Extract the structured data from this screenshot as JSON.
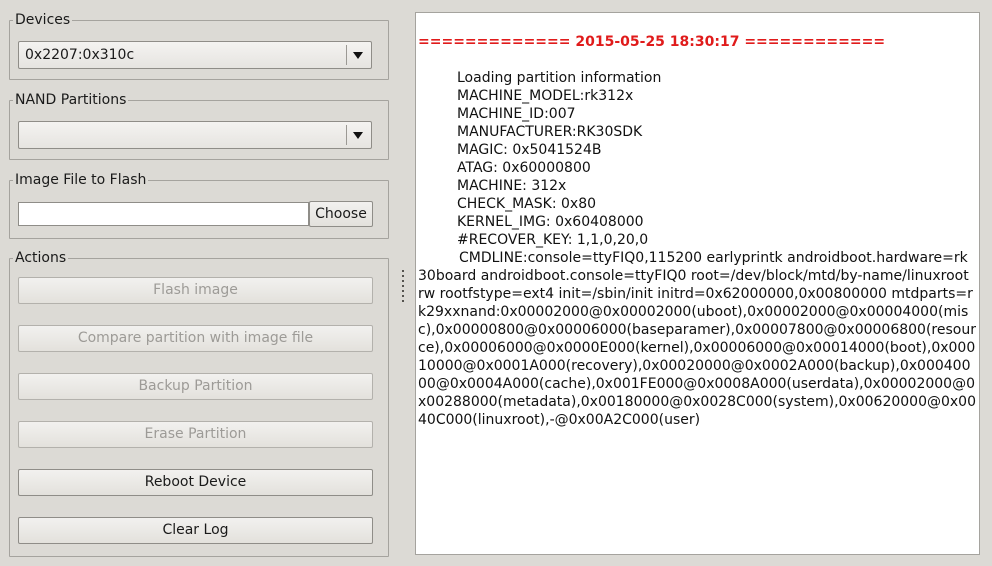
{
  "devices": {
    "title": "Devices",
    "selected": "0x2207:0x310c"
  },
  "nand_partitions": {
    "title": "NAND Partitions",
    "selected": ""
  },
  "image_file": {
    "title": "Image File to Flash",
    "value": "",
    "choose_label": "Choose"
  },
  "actions": {
    "title": "Actions",
    "flash_image": "Flash image",
    "compare_partition": "Compare partition with image file",
    "backup_partition": "Backup Partition",
    "erase_partition": "Erase Partition",
    "reboot_device": "Reboot Device",
    "clear_log": "Clear Log"
  },
  "log": {
    "header": "============= 2015-05-25 18:30:17 ============",
    "lines": [
      "Loading partition information",
      "MACHINE_MODEL:rk312x",
      "MACHINE_ID:007",
      "MANUFACTURER:RK30SDK",
      "MAGIC: 0x5041524B",
      "ATAG: 0x60000800",
      "MACHINE: 312x",
      "CHECK_MASK: 0x80",
      "KERNEL_IMG: 0x60408000",
      "#RECOVER_KEY: 1,1,0,20,0"
    ],
    "cmdline": "CMDLINE:console=ttyFIQ0,115200 earlyprintk androidboot.hardware=rk30board androidboot.console=ttyFIQ0 root=/dev/block/mtd/by-name/linuxroot rw rootfstype=ext4 init=/sbin/init initrd=0x62000000,0x00800000 mtdparts=rk29xxnand:0x00002000@0x00002000(uboot),0x00002000@0x00004000(misc),0x00000800@0x00006000(baseparamer),0x00007800@0x00006800(resource),0x00006000@0x0000E000(kernel),0x00006000@0x00014000(boot),0x00010000@0x0001A000(recovery),0x00020000@0x0002A000(backup),0x00040000@0x0004A000(cache),0x001FE000@0x0008A000(userdata),0x00002000@0x00288000(metadata),0x00180000@0x0028C000(system),0x00620000@0x0040C000(linuxroot),-@0x00A2C000(user)"
  }
}
